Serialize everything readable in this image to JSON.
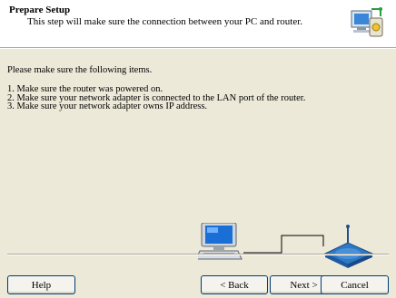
{
  "header": {
    "title": "Prepare Setup",
    "subtitle": "This step will make sure the connection between your PC and router."
  },
  "content": {
    "intro": "Please make sure the following items.",
    "steps": [
      "1. Make sure the router was powered on.",
      "2. Make sure your network adapter is connected to the LAN port of the router.",
      "3. Make sure your network adapter owns IP address."
    ]
  },
  "buttons": {
    "help": "Help",
    "back": "< Back",
    "next": "Next >",
    "cancel": "Cancel"
  },
  "icons": {
    "header": "setup-wizard-icon",
    "computer": "computer-icon",
    "router": "router-icon"
  },
  "colors": {
    "dialog_background": "#ece9d8",
    "header_background": "#ffffff",
    "monitor_screen": "#1a6fd6",
    "router_body": "#2f78c4"
  }
}
